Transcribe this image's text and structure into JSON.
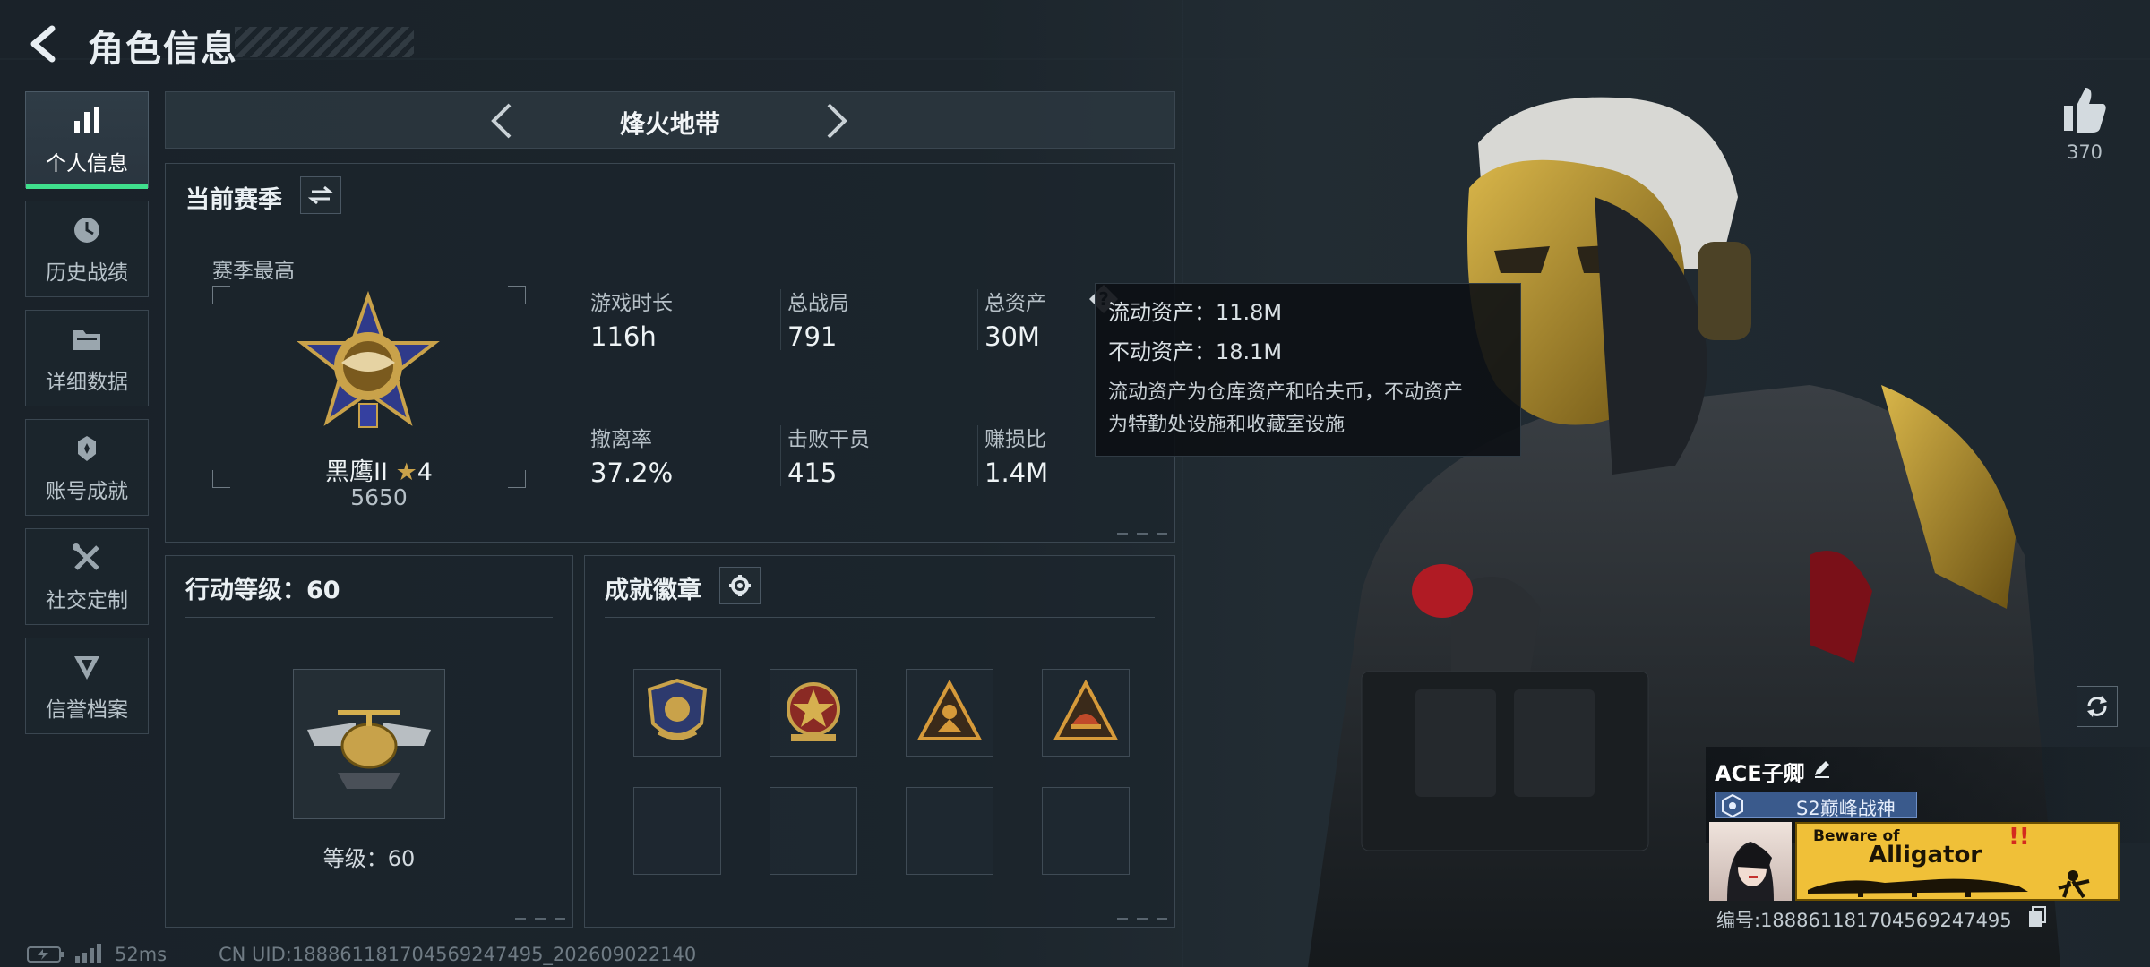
{
  "header": {
    "title": "角色信息"
  },
  "sidebar": {
    "items": [
      {
        "label": "个人信息",
        "icon": "bar-chart-icon",
        "active": true
      },
      {
        "label": "历史战绩",
        "icon": "history-clock-icon",
        "active": false
      },
      {
        "label": "详细数据",
        "icon": "folder-icon",
        "active": false
      },
      {
        "label": "账号成就",
        "icon": "achievement-icon",
        "active": false
      },
      {
        "label": "社交定制",
        "icon": "tools-icon",
        "active": false
      },
      {
        "label": "信誉档案",
        "icon": "reputation-icon",
        "active": false
      }
    ]
  },
  "mode": {
    "title": "烽火地带"
  },
  "season": {
    "title": "当前赛季",
    "best_label": "赛季最高",
    "rank_name": "黑鹰II",
    "rank_stars": "4",
    "rank_score": "5650",
    "stats": [
      {
        "label": "游戏时长",
        "value": "116h"
      },
      {
        "label": "总战局",
        "value": "791"
      },
      {
        "label": "总资产",
        "value": "30M"
      },
      {
        "label": "撤离率",
        "value": "37.2%"
      },
      {
        "label": "击败干员",
        "value": "415"
      },
      {
        "label": "赚损比",
        "value": "1.4M"
      }
    ]
  },
  "tooltip": {
    "line1": "流动资产：11.8M",
    "line2": "不动资产：18.1M",
    "desc1": "流动资产为仓库资产和哈夫币，不动资产",
    "desc2": "为特勤处设施和收藏室设施"
  },
  "action_level": {
    "title": "行动等级：60",
    "level_label": "等级：60"
  },
  "badges": {
    "title": "成就徽章",
    "slots": 8,
    "filled": 4
  },
  "likes": {
    "count": "370"
  },
  "player": {
    "name": "ACE子卿",
    "title_tag": "S2巅峰战神",
    "banner_text1": "Beware of",
    "banner_text2": "Alligator",
    "id_text": "编号:188861181704569247495"
  },
  "footer": {
    "ping": "52ms",
    "uid": "CN UID:188861181704569247495_202609022140"
  },
  "colors": {
    "accent": "#3fe08d",
    "panel_border": "#3b4751",
    "background": "#1c252c"
  }
}
